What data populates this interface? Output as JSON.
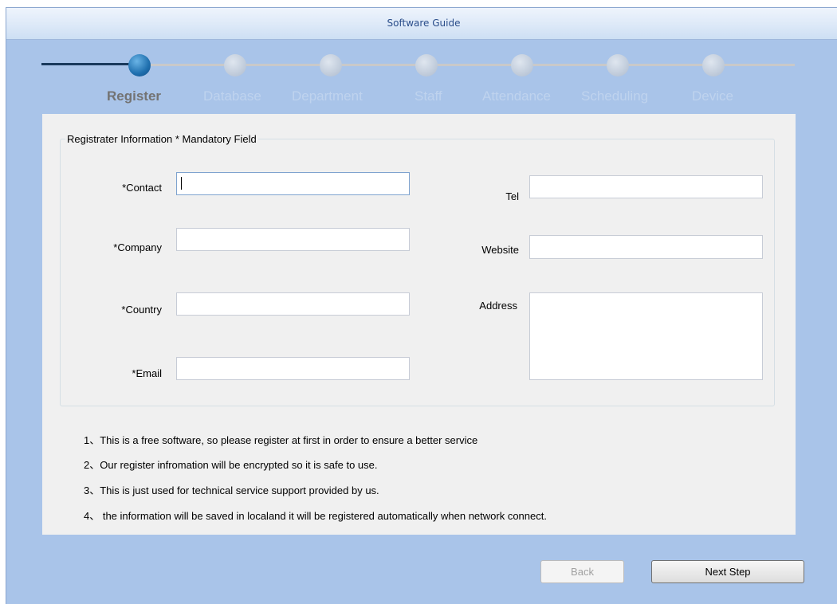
{
  "window": {
    "title": "Software Guide"
  },
  "steps": [
    {
      "label": "Register",
      "active": true
    },
    {
      "label": "Database",
      "active": false
    },
    {
      "label": "Department",
      "active": false
    },
    {
      "label": "Staff",
      "active": false
    },
    {
      "label": "Attendance",
      "active": false
    },
    {
      "label": "Scheduling",
      "active": false
    },
    {
      "label": "Device",
      "active": false
    }
  ],
  "form": {
    "group_title": "Registrater Information * Mandatory Field",
    "contact": {
      "label": "*Contact",
      "value": ""
    },
    "company": {
      "label": "*Company",
      "value": ""
    },
    "country": {
      "label": "*Country",
      "value": ""
    },
    "email": {
      "label": "*Email",
      "value": ""
    },
    "tel": {
      "label": "Tel",
      "value": ""
    },
    "website": {
      "label": "Website",
      "value": ""
    },
    "address": {
      "label": "Address",
      "value": ""
    }
  },
  "notes": [
    "1、This is a free software, so please register at first in order to ensure a better service",
    "2、Our register infromation will be encrypted so it is safe to use.",
    "3、This is just used for technical service support provided by us.",
    "4、 the information will be saved in localand it will be registered automatically when network connect."
  ],
  "buttons": {
    "back": "Back",
    "next": "Next Step"
  }
}
